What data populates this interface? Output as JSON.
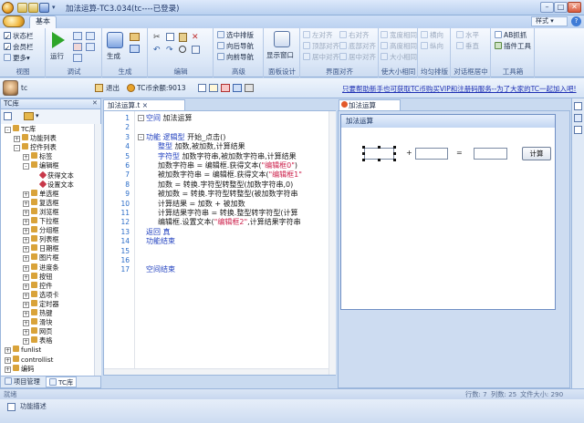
{
  "window": {
    "title": "加法运算-TC3.034(tc----已登录)",
    "style_label": "样式"
  },
  "tabs": {
    "basic": "基本"
  },
  "ribbon": {
    "view": {
      "label": "视图",
      "items": [
        "状态栏",
        "会员栏",
        "更多"
      ]
    },
    "debug": {
      "label": "调试",
      "run": "运行"
    },
    "generate": {
      "label": "生成"
    },
    "edit": {
      "label": "编辑"
    },
    "advanced": {
      "label": "高级",
      "items": [
        "选中排版",
        "向后导航",
        "向前导航"
      ]
    },
    "panel": {
      "label": "面板设计",
      "show": "显示窗口"
    },
    "align": {
      "label": "界面对齐",
      "items": [
        "左对齐",
        "右对齐",
        "顶部对齐",
        "底部对齐",
        "居中对齐",
        "居中对齐"
      ]
    },
    "same_size": {
      "label": "使大小相同",
      "items": [
        "宽度相同",
        "高度相同",
        "大小相同"
      ]
    },
    "distribute": {
      "label": "均匀排版",
      "items": [
        "横向",
        "纵向"
      ]
    },
    "center": {
      "label": "对话框居中",
      "items": [
        "水平",
        "垂直"
      ]
    },
    "tools": {
      "label": "工具箱",
      "items": [
        "AB抓抓",
        "插件工具"
      ]
    }
  },
  "toolbar2": {
    "user": "tc",
    "exit": "退出",
    "coins": "TC币余额:9013",
    "promo": "只要帮助新手也可获取TC币购买VIP和注册码服务--为了大家的TC一起加入吧!"
  },
  "left_panel": {
    "title": "TC库",
    "tree": [
      {
        "label": "TC库",
        "level": 0,
        "expander": "-",
        "icon": "folder"
      },
      {
        "label": "功能列表",
        "level": 1,
        "expander": "+",
        "icon": "folder"
      },
      {
        "label": "控件列表",
        "level": 1,
        "expander": "-",
        "icon": "folder"
      },
      {
        "label": "标签",
        "level": 2,
        "expander": "+",
        "icon": "folder"
      },
      {
        "label": "编辑框",
        "level": 2,
        "expander": "-",
        "icon": "folder"
      },
      {
        "label": "获得文本",
        "level": 3,
        "expander": "",
        "icon": "method"
      },
      {
        "label": "设置文本",
        "level": 3,
        "expander": "",
        "icon": "method"
      },
      {
        "label": "单选框",
        "level": 2,
        "expander": "+",
        "icon": "folder"
      },
      {
        "label": "复选框",
        "level": 2,
        "expander": "+",
        "icon": "folder"
      },
      {
        "label": "浏览框",
        "level": 2,
        "expander": "+",
        "icon": "folder"
      },
      {
        "label": "下拉框",
        "level": 2,
        "expander": "+",
        "icon": "folder"
      },
      {
        "label": "分组框",
        "level": 2,
        "expander": "+",
        "icon": "folder"
      },
      {
        "label": "列表框",
        "level": 2,
        "expander": "+",
        "icon": "folder"
      },
      {
        "label": "日期框",
        "level": 2,
        "expander": "+",
        "icon": "folder"
      },
      {
        "label": "图片框",
        "level": 2,
        "expander": "+",
        "icon": "folder"
      },
      {
        "label": "进度条",
        "level": 2,
        "expander": "+",
        "icon": "folder"
      },
      {
        "label": "按钮",
        "level": 2,
        "expander": "+",
        "icon": "folder"
      },
      {
        "label": "控件",
        "level": 2,
        "expander": "+",
        "icon": "folder"
      },
      {
        "label": "选项卡",
        "level": 2,
        "expander": "+",
        "icon": "folder"
      },
      {
        "label": "定时器",
        "level": 2,
        "expander": "+",
        "icon": "folder"
      },
      {
        "label": "热键",
        "level": 2,
        "expander": "+",
        "icon": "folder"
      },
      {
        "label": "滑块",
        "level": 2,
        "expander": "+",
        "icon": "folder"
      },
      {
        "label": "网页",
        "level": 2,
        "expander": "+",
        "icon": "folder"
      },
      {
        "label": "表格",
        "level": 2,
        "expander": "+",
        "icon": "folder"
      },
      {
        "label": "funlist",
        "level": 0,
        "expander": "+",
        "icon": "folder"
      },
      {
        "label": "controllist",
        "level": 0,
        "expander": "+",
        "icon": "folder"
      },
      {
        "label": "编码",
        "level": 0,
        "expander": "+",
        "icon": "folder"
      }
    ],
    "tabs": [
      "项目管理",
      "TC库"
    ]
  },
  "editor": {
    "tab": "加法运算.t",
    "lines": [
      [
        {
          "t": "空间 ",
          "c": "kw"
        },
        {
          "t": "加法运算",
          "c": "vr"
        }
      ],
      [],
      [
        {
          "t": "功能 ",
          "c": "kw"
        },
        {
          "t": "逻辑型 ",
          "c": "kw"
        },
        {
          "t": "开始_点击()",
          "c": "vr"
        }
      ],
      [
        {
          "t": "整型 ",
          "c": "kw"
        },
        {
          "t": "加数,被加数,计算结果",
          "c": "vr"
        }
      ],
      [
        {
          "t": "字符型 ",
          "c": "kw"
        },
        {
          "t": "加数字符串,被加数字符串,计算结果",
          "c": "vr"
        }
      ],
      [
        {
          "t": "加数字符串 = 编辑框.获得文本(",
          "c": "vr"
        },
        {
          "t": "\"编辑框0\"",
          "c": "st"
        },
        {
          "t": ")",
          "c": "vr"
        }
      ],
      [
        {
          "t": "被加数字符串 = 编辑框.获得文本(",
          "c": "vr"
        },
        {
          "t": "\"编辑框1\"",
          "c": "st"
        }
      ],
      [
        {
          "t": "加数 = 转换.字符型转整型(加数字符串,0)",
          "c": "vr"
        }
      ],
      [
        {
          "t": "被加数 = 转换.字符型转整型(被加数字符串",
          "c": "vr"
        }
      ],
      [
        {
          "t": "计算结果 = 加数 + 被加数",
          "c": "vr"
        }
      ],
      [
        {
          "t": "计算结果字符串 = 转换.整型转字符型(计算",
          "c": "vr"
        }
      ],
      [
        {
          "t": "编辑框.设置文本(",
          "c": "vr"
        },
        {
          "t": "\"编辑框2\"",
          "c": "st"
        },
        {
          "t": ",计算结果字符串",
          "c": "vr"
        }
      ],
      [
        {
          "t": "返回 ",
          "c": "kw"
        },
        {
          "t": "真",
          "c": "kw"
        }
      ],
      [
        {
          "t": "功能结束",
          "c": "kw"
        }
      ],
      [],
      [],
      [
        {
          "t": "空间结束",
          "c": "kw"
        }
      ]
    ],
    "line_numbers": [
      "1",
      "2",
      "3",
      "4",
      "5",
      "6",
      "7",
      "8",
      "9",
      "10",
      "11",
      "12",
      "13",
      "14",
      "15",
      "16",
      "17"
    ]
  },
  "design": {
    "tab": "加法运算",
    "form_title": "加法运算",
    "plus": "+",
    "equals": "=",
    "calc_button": "计算"
  },
  "status": {
    "ready": "就绪",
    "line": "行数: 7",
    "col": "列数: 25",
    "length": "文件大小: 290",
    "func_desc": "功能描述"
  }
}
